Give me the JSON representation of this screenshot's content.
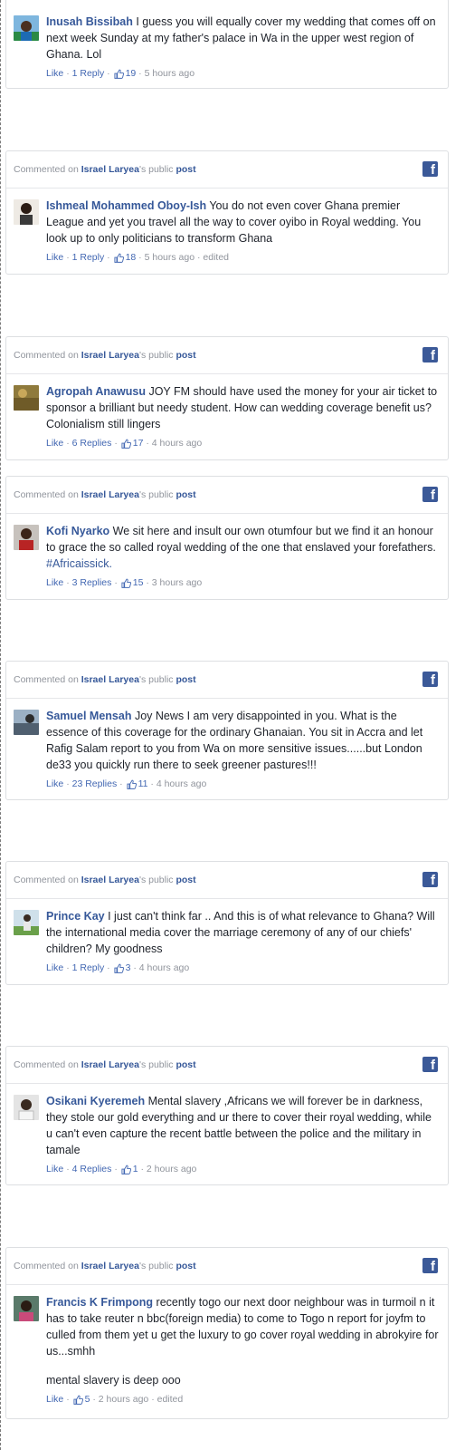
{
  "header": {
    "prefix": "Commented on",
    "page_name": "Israel Laryea",
    "possessive": "'s public",
    "post_label": "post"
  },
  "meta_labels": {
    "like": "Like",
    "sep": "·"
  },
  "colors": {
    "link": "#365899",
    "facebook_blue": "#3b5998",
    "meta": "#90949c"
  },
  "comments": [
    {
      "author": "Inusah Bissibah",
      "text": " I guess you will equally cover my wedding that comes off on next week Sunday at my father's palace in Wa in the upper west region of Ghana. Lol",
      "replies": "1 Reply",
      "likes": "19",
      "time": "5 hours ago",
      "edited": ""
    },
    {
      "author": "Ishmeal Mohammed Oboy-Ish",
      "text": " You do not even cover Ghana premier League and yet you travel all the way to cover oyibo in Royal wedding. You look up to only politicians to transform Ghana",
      "replies": "1 Reply",
      "likes": "18",
      "time": "5 hours ago",
      "edited": "edited"
    },
    {
      "author": "Agropah Anawusu",
      "text": " JOY FM should have used the money for your air ticket to sponsor a brilliant but needy student. How can wedding coverage benefit us? Colonialism still lingers",
      "replies": "6 Replies",
      "likes": "17",
      "time": "4 hours ago",
      "edited": ""
    },
    {
      "author": "Kofi Nyarko",
      "text": " We sit here and insult our own otumfour but we find it an honour to grace the so called royal wedding of the one that enslaved your forefathers. ",
      "hashtag": "#Africaissick.",
      "replies": "3 Replies",
      "likes": "15",
      "time": "3 hours ago",
      "edited": ""
    },
    {
      "author": "Samuel Mensah",
      "text": " Joy News I am very disappointed in you. What is the essence of this coverage for the ordinary Ghanaian. You sit in Accra and let Rafig Salam report to you from Wa on more sensitive issues......but London de33 you quickly run there to seek greener pastures!!!",
      "replies": "23 Replies",
      "likes": "11",
      "time": "4 hours ago",
      "edited": ""
    },
    {
      "author": "Prince Kay",
      "text": " I just can't think far .. And this is of what relevance to Ghana? Will the international media cover the marriage ceremony of any of our chiefs' children? My goodness",
      "replies": "1 Reply",
      "likes": "3",
      "time": "4 hours ago",
      "edited": ""
    },
    {
      "author": "Osikani Kyeremeh",
      "text": " Mental slavery ,Africans we will forever be in darkness, they stole our gold everything and ur there to cover their royal wedding, while u can't even capture the recent battle between the police and the military in tamale",
      "replies": "4 Replies",
      "likes": "1",
      "time": "2 hours ago",
      "edited": ""
    },
    {
      "author": "Francis K Frimpong",
      "text": " recently togo our next door neighbour was in turmoil n it has to take reuter n bbc(foreign media) to come to Togo n report for joyfm to culled from them yet u get the luxury to go cover royal wedding in abrokyire for us...smhh",
      "extra": "mental slavery is deep ooo",
      "replies": "",
      "likes": "5",
      "time": "2 hours ago",
      "edited": "edited"
    }
  ]
}
